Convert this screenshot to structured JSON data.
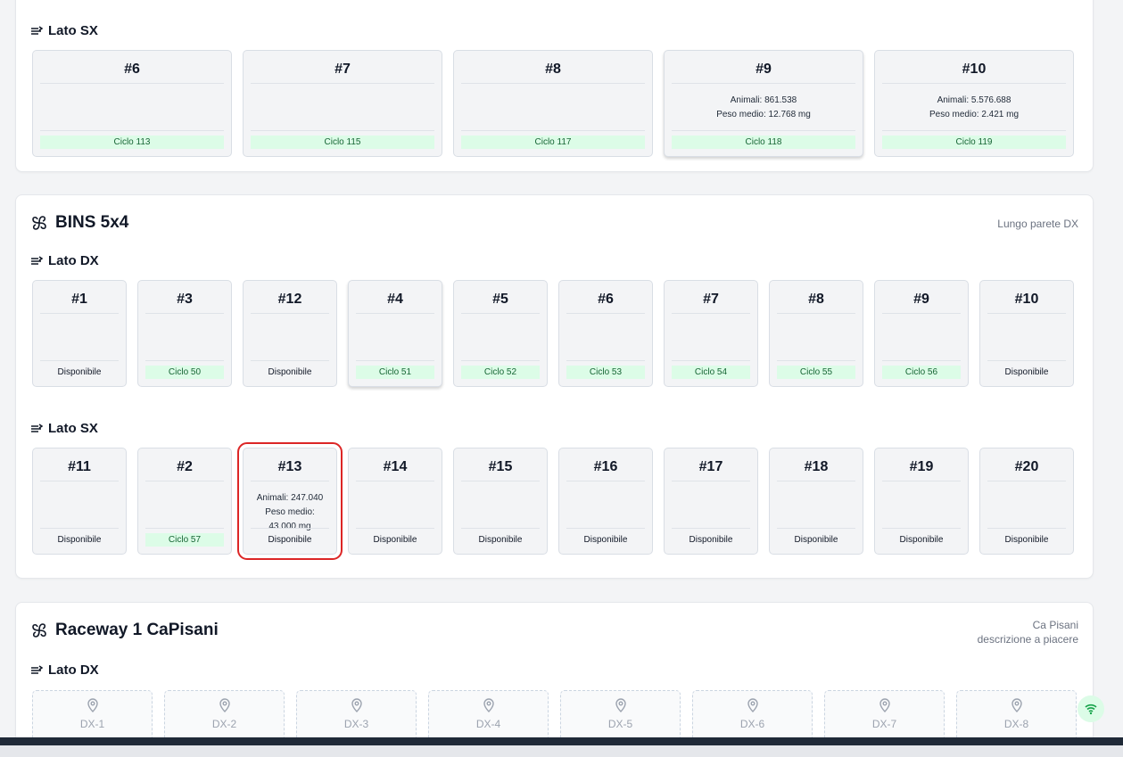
{
  "sections": [
    {
      "id": "top",
      "side_label": "Lato SX",
      "cards": [
        {
          "num": "#6",
          "status": "Ciclo 113",
          "status_type": "cycle"
        },
        {
          "num": "#7",
          "status": "Ciclo 115",
          "status_type": "cycle"
        },
        {
          "num": "#8",
          "status": "Ciclo 117",
          "status_type": "cycle"
        },
        {
          "num": "#9",
          "animals": "Animali: 861.538",
          "weight": "Peso medio: 12.768 mg",
          "status": "Ciclo 118",
          "status_type": "cycle"
        },
        {
          "num": "#10",
          "animals": "Animali: 5.576.688",
          "weight": "Peso medio: 2.421 mg",
          "status": "Ciclo 119",
          "status_type": "cycle"
        }
      ]
    },
    {
      "id": "bins",
      "title": "BINS 5x4",
      "description": "Lungo parete DX",
      "dx": {
        "label": "Lato DX",
        "cards": [
          {
            "num": "#1",
            "status": "Disponibile",
            "status_type": "free"
          },
          {
            "num": "#3",
            "status": "Ciclo 50",
            "status_type": "cycle"
          },
          {
            "num": "#12",
            "status": "Disponibile",
            "status_type": "free"
          },
          {
            "num": "#4",
            "status": "Ciclo 51",
            "status_type": "cycle"
          },
          {
            "num": "#5",
            "status": "Ciclo 52",
            "status_type": "cycle"
          },
          {
            "num": "#6",
            "status": "Ciclo 53",
            "status_type": "cycle"
          },
          {
            "num": "#7",
            "status": "Ciclo 54",
            "status_type": "cycle"
          },
          {
            "num": "#8",
            "status": "Ciclo 55",
            "status_type": "cycle"
          },
          {
            "num": "#9",
            "status": "Ciclo 56",
            "status_type": "cycle"
          },
          {
            "num": "#10",
            "status": "Disponibile",
            "status_type": "free"
          }
        ]
      },
      "sx": {
        "label": "Lato SX",
        "cards": [
          {
            "num": "#11",
            "status": "Disponibile",
            "status_type": "free"
          },
          {
            "num": "#2",
            "status": "Ciclo 57",
            "status_type": "cycle"
          },
          {
            "num": "#13",
            "animals": "Animali: 247.040",
            "weight": "Peso medio:",
            "weight2": "43.000 mg",
            "status": "Disponibile",
            "status_type": "free",
            "selected": true
          },
          {
            "num": "#14",
            "status": "Disponibile",
            "status_type": "free"
          },
          {
            "num": "#15",
            "status": "Disponibile",
            "status_type": "free"
          },
          {
            "num": "#16",
            "status": "Disponibile",
            "status_type": "free"
          },
          {
            "num": "#17",
            "status": "Disponibile",
            "status_type": "free"
          },
          {
            "num": "#18",
            "status": "Disponibile",
            "status_type": "free"
          },
          {
            "num": "#19",
            "status": "Disponibile",
            "status_type": "free"
          },
          {
            "num": "#20",
            "status": "Disponibile",
            "status_type": "free"
          }
        ]
      }
    },
    {
      "id": "raceway",
      "title": "Raceway 1 CaPisani",
      "description_line1": "Ca Pisani",
      "description_line2": "descrizione a piacere",
      "dx": {
        "label": "Lato DX",
        "slots": [
          "DX-1",
          "DX-2",
          "DX-3",
          "DX-4",
          "DX-5",
          "DX-6",
          "DX-7",
          "DX-8"
        ]
      }
    }
  ],
  "colors": {
    "cycle_bg": "#dcfce7",
    "cycle_text": "#166534",
    "selected_outline": "#dc2626",
    "card_bg": "#f3f4f6"
  },
  "icons": {
    "side": "lines-arrow-icon",
    "section": "fan-icon",
    "slot": "map-pin-icon",
    "status": "wifi-icon"
  }
}
